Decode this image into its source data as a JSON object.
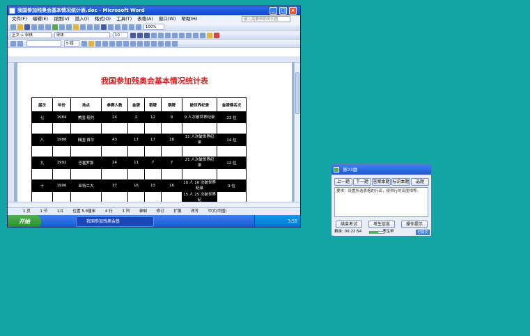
{
  "word": {
    "title": "我国参加残奥会基本情况统计表.doc - Microsoft Word",
    "window_buttons": {
      "minimize": "_",
      "maximize": "□",
      "close": "×"
    },
    "menu": [
      "文件(F)",
      "编辑(E)",
      "视图(V)",
      "插入(I)",
      "格式(O)",
      "工具(T)",
      "表格(A)",
      "窗口(W)",
      "帮助(H)"
    ],
    "help_placeholder": "键入需要帮助的问题",
    "toolbar": {
      "zoom": "100%",
      "style": "正文 + 宋体",
      "font": "宋体",
      "size": "10",
      "size2": "5 磅"
    },
    "doc_title": "我国参加残奥会基本情况统计表",
    "table": {
      "headers": [
        "届次",
        "年份",
        "地点",
        "参赛人数",
        "金牌",
        "银牌",
        "铜牌",
        "破世界纪录",
        "金牌榜名次"
      ],
      "rows": [
        [
          "七",
          "1984",
          "美国 纽约",
          "24",
          "2",
          "12",
          "9",
          "9 人次破世界纪录",
          "23 位"
        ],
        [
          "",
          "",
          "",
          "",
          "",
          "",
          "",
          "",
          ""
        ],
        [
          "八",
          "1988",
          "韩国 首尔",
          "43",
          "17",
          "17",
          "18",
          "11 人次破世界纪录",
          "14 位"
        ],
        [
          "",
          "",
          "",
          "",
          "",
          "",
          "",
          "",
          ""
        ],
        [
          "九",
          "1992",
          "巴塞罗那",
          "24",
          "11",
          "7",
          "7",
          "21 人次破世界纪录",
          "12 位"
        ],
        [
          "",
          "",
          "",
          "",
          "",
          "",
          "",
          "",
          ""
        ],
        [
          "十",
          "1996",
          "亚特兰大",
          "37",
          "16",
          "13",
          "16",
          "10 人 16 次破世界纪录",
          "9 位"
        ],
        [
          "",
          "",
          "",
          "",
          "",
          "",
          "",
          "15 人 25 次破世界纪",
          ""
        ]
      ]
    },
    "status": [
      "1 页",
      "1 节",
      "1/1",
      "位置 5.3厘米",
      "4 行",
      "1 列",
      "录制",
      "修订",
      "扩展",
      "改写",
      "中文(中国)"
    ],
    "taskbar": {
      "start": "开始",
      "item": "我国参加残奥会基",
      "clock": "3:55"
    }
  },
  "exam": {
    "title": "第23题",
    "nav": [
      "上一题",
      "下一题",
      "答案本题",
      "标识本题",
      "选题"
    ],
    "question": "要求：设置所选表格的行高，使得行的高度相等。",
    "buttons": [
      "结束考试",
      "考生信息",
      "操作提示"
    ],
    "remaining_label": "剩余: 00:22:54",
    "progress": 0.6,
    "candidate": "考生甲",
    "badge": "已提交"
  },
  "colors": {
    "desktop": "#13a5a5",
    "title_red": "#d42020",
    "xp_blue": "#1c55d0"
  }
}
